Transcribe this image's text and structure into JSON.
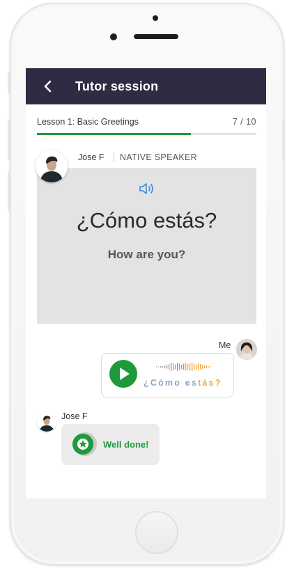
{
  "header": {
    "title": "Tutor session",
    "back_icon": "chevron-left-icon"
  },
  "lesson": {
    "title": "Lesson 1: Basic Greetings",
    "progress_text": "7 / 10",
    "progress_fraction": 0.7
  },
  "tutor": {
    "name": "Jose F",
    "role": "NATIVE SPEAKER"
  },
  "card": {
    "sound_icon": "speaker-icon",
    "phrase": "¿Cómo estás?",
    "translation": "How are you?"
  },
  "me": {
    "label": "Me",
    "play_icon": "play-icon",
    "spoken_parts": [
      {
        "text": "¿Cómo ",
        "status": "ok"
      },
      {
        "text": "es",
        "status": "ok"
      },
      {
        "text": "tás?",
        "status": "warn"
      }
    ]
  },
  "reply": {
    "name": "Jose F",
    "message": "Well done!",
    "badge_icon": "star-badge-icon"
  },
  "colors": {
    "header_bg": "#2e2c43",
    "accent_green": "#1e9a3d",
    "card_bg": "#e3e3e3",
    "correct_text": "#8aa5c7",
    "mistake_text": "#f3a64a"
  }
}
